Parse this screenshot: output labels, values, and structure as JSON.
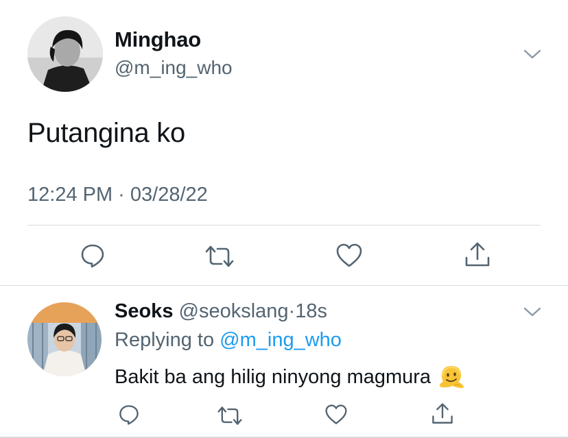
{
  "tweet": {
    "author_name": "Minghao",
    "author_handle": "@m_ing_who",
    "text": "Putangina ko",
    "timestamp": "12:24 PM · 03/28/22"
  },
  "reply": {
    "author_name": "Seoks",
    "author_handle": "@seokslang",
    "separator": "·",
    "time_ago": "18s",
    "replying_prefix": "Replying to",
    "replying_handle": "@m_ing_who",
    "text": "Bakit ba ang hilig ninyong magmura"
  },
  "icons": {
    "menu": "chevron-down-icon",
    "reply": "reply-bubble-icon",
    "retweet": "retweet-icon",
    "like": "heart-icon",
    "share": "share-icon",
    "emoji": "melting-face-emoji"
  },
  "colors": {
    "text": "#0f1419",
    "secondary": "#536471",
    "link": "#1d9bf0",
    "divider": "#d6dbe0"
  }
}
